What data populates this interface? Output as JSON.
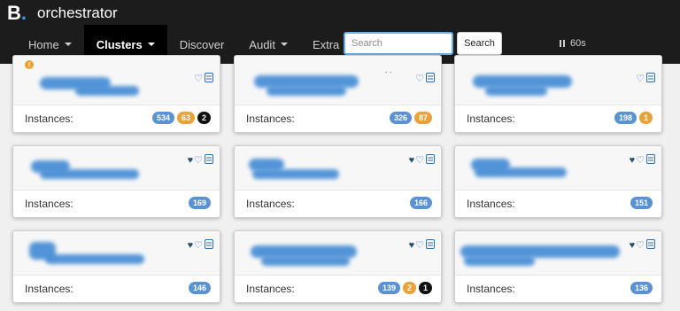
{
  "brand": {
    "logo_letter": "B",
    "logo_dot": ".",
    "name": "orchestrator"
  },
  "nav": {
    "items": [
      {
        "label": "Home",
        "has_dropdown": true,
        "active": false
      },
      {
        "label": "Clusters",
        "has_dropdown": true,
        "active": true
      },
      {
        "label": "Discover",
        "has_dropdown": false,
        "active": false
      },
      {
        "label": "Audit",
        "has_dropdown": true,
        "active": false
      },
      {
        "label": "Extra",
        "has_dropdown": true,
        "active": false
      }
    ],
    "search_placeholder": "Search",
    "search_value": "",
    "search_button": "Search",
    "refresh_label": "60s"
  },
  "clusters": {
    "instances_label": "Instances:",
    "cards": [
      {
        "warning": true,
        "warning_glyph": "!",
        "name_redacted": true,
        "counts": [
          "534",
          "63",
          "2"
        ],
        "favorite": false
      },
      {
        "warning": false,
        "name_redacted": true,
        "counts": [
          "326",
          "87"
        ],
        "favorite": false
      },
      {
        "warning": false,
        "name_redacted": true,
        "counts": [
          "198",
          "1"
        ],
        "favorite": false
      },
      {
        "warning": false,
        "name_redacted": true,
        "counts": [
          "169"
        ],
        "favorite": true
      },
      {
        "warning": false,
        "name_redacted": true,
        "counts": [
          "166"
        ],
        "favorite": true
      },
      {
        "warning": false,
        "name_redacted": true,
        "counts": [
          "151"
        ],
        "favorite": true
      },
      {
        "warning": false,
        "name_redacted": true,
        "counts": [
          "146"
        ],
        "favorite": true
      },
      {
        "warning": false,
        "name_redacted": true,
        "counts": [
          "139",
          "2",
          "1"
        ],
        "favorite": true
      },
      {
        "warning": false,
        "name_redacted": true,
        "counts": [
          "136"
        ],
        "favorite": true
      }
    ]
  },
  "colors": {
    "topbar": "#1c1c1c",
    "badge_ok": "#5b93d1",
    "badge_lag": "#e9a23b",
    "badge_down": "#111111",
    "redaction": "#4a8fd6"
  }
}
